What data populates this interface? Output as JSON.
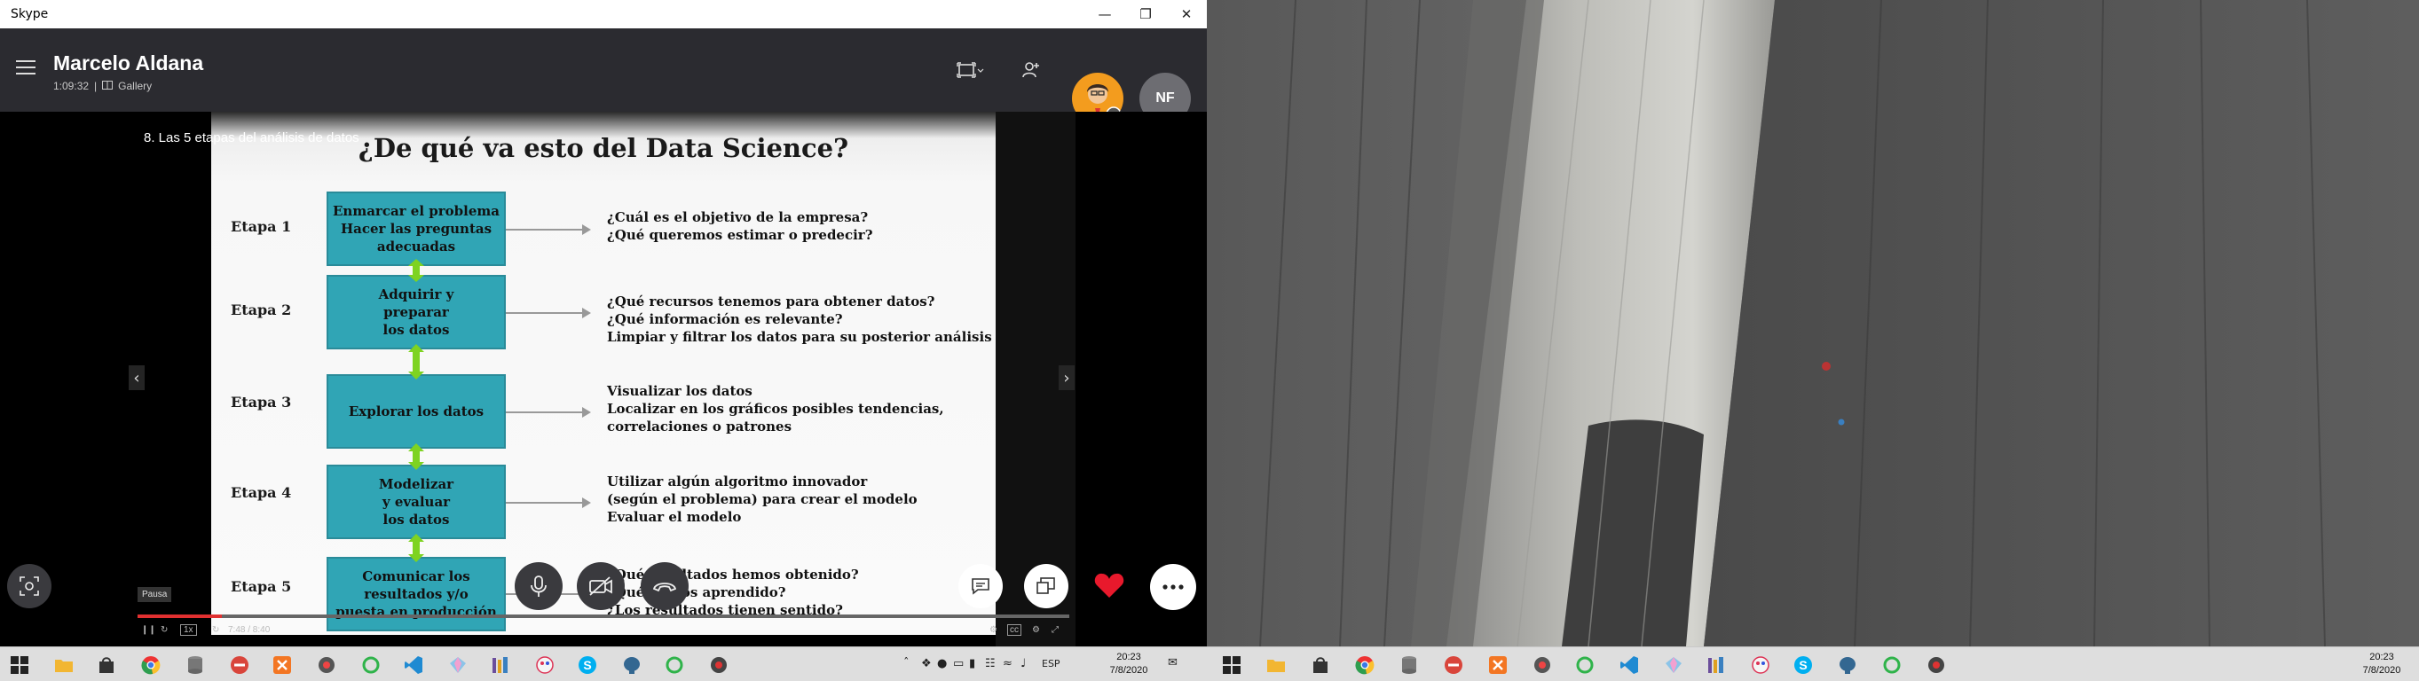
{
  "window": {
    "title": "Skype"
  },
  "call": {
    "contact_name": "Marcelo Aldana",
    "duration": "1:09:32",
    "separator": "|",
    "view_mode": "Gallery",
    "participant_initials": "NF"
  },
  "video": {
    "caption": "8. Las 5 etapas del análisis de datos",
    "tooltip": "Pausa",
    "speed": "1x",
    "time": "7:48 / 8:40",
    "progress": 0.09
  },
  "slide": {
    "title": "¿De qué va esto del Data Science?",
    "stages": [
      {
        "label": "Etapa 1",
        "box": "Enmarcar el problema\nHacer las preguntas\nadecuadas",
        "questions": [
          "¿Cuál es el objetivo de la empresa?",
          "¿Qué queremos estimar o predecir?"
        ]
      },
      {
        "label": "Etapa 2",
        "box": "Adquirir y\npreparar\nlos datos",
        "questions": [
          "¿Qué recursos tenemos para obtener datos?",
          "¿Qué información es relevante?",
          "Limpiar y filtrar los datos para su posterior análisis"
        ]
      },
      {
        "label": "Etapa 3",
        "box": "Explorar los datos",
        "questions": [
          "Visualizar los datos",
          "Localizar en los gráficos posibles tendencias,",
          "correlaciones o patrones"
        ]
      },
      {
        "label": "Etapa 4",
        "box": "Modelizar\ny evaluar\nlos datos",
        "questions": [
          "Utilizar algún algoritmo innovador",
          "(según el problema) para crear el modelo",
          "Evaluar el modelo"
        ]
      },
      {
        "label": "Etapa 5",
        "box": "Comunicar los\nresultados y/o\npuesta en producción",
        "questions": [
          "¿Qué resultados hemos obtenido?",
          "¿Qué hemos aprendido?",
          "¿Los resultados tienen sentido?"
        ]
      }
    ]
  },
  "taskbar": {
    "language": "ESP",
    "time": "20:23",
    "date": "7/8/2020"
  },
  "colors": {
    "accent_red": "#e03030",
    "teal_box": "#30a5b5",
    "green_connector": "#7ed321",
    "heart": "#e8192c"
  }
}
